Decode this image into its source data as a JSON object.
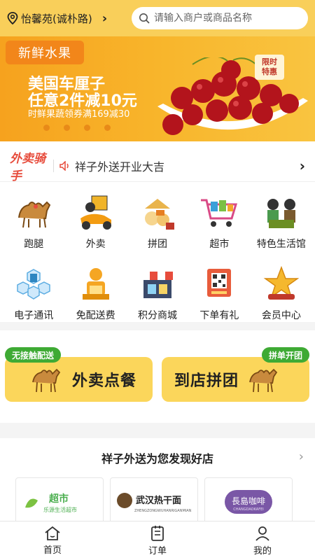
{
  "header": {
    "location": "怡馨苑(诚朴路)",
    "search_placeholder": "请输入商户或商品名称"
  },
  "banner": {
    "tag": "新鲜水果",
    "title_line1": "美国车厘子",
    "title_line2": "任意2件减10元",
    "subtitle": "时鲜果蔬领券满169减30",
    "badge_line1": "限时",
    "badge_line2": "特惠"
  },
  "notice": {
    "brand": "外卖骑手",
    "text": "祥子外送开业大吉"
  },
  "categories_row1": [
    {
      "label": "跑腿",
      "icon": "camel-icon"
    },
    {
      "label": "外卖",
      "icon": "delivery-scooter-icon"
    },
    {
      "label": "拼团",
      "icon": "group-buy-icon"
    },
    {
      "label": "超市",
      "icon": "shopping-cart-icon"
    },
    {
      "label": "特色生活馆",
      "icon": "specialty-shop-icon"
    }
  ],
  "categories_row2": [
    {
      "label": "电子通讯",
      "icon": "electronics-icon"
    },
    {
      "label": "免配送费",
      "icon": "free-delivery-icon"
    },
    {
      "label": "积分商城",
      "icon": "points-mall-icon"
    },
    {
      "label": "下单有礼",
      "icon": "order-gift-icon"
    },
    {
      "label": "会员中心",
      "icon": "member-star-icon"
    }
  ],
  "big_buttons": {
    "takeout": {
      "pill": "无接触配送",
      "label": "外卖点餐"
    },
    "groupbuy": {
      "pill": "拼单开团",
      "label": "到店拼团"
    }
  },
  "discover": {
    "heading": "祥子外送为您发现好店",
    "shops": [
      {
        "name": "超市",
        "sub": "乐源生活超市"
      },
      {
        "name": "武汉热干面",
        "sub": "ZHENGZONGWUHANRIGANMIAN"
      },
      {
        "name": "長島咖啡",
        "sub": "CHANGDAOKAFEI"
      }
    ]
  },
  "nav": {
    "home": "首页",
    "orders": "订单",
    "mine": "我的"
  },
  "colors": {
    "brand_yellow": "#f9cf5a",
    "banner_orange": "#f6a21e",
    "pill_green": "#3eaa34",
    "button_yellow": "#fbd65b"
  }
}
